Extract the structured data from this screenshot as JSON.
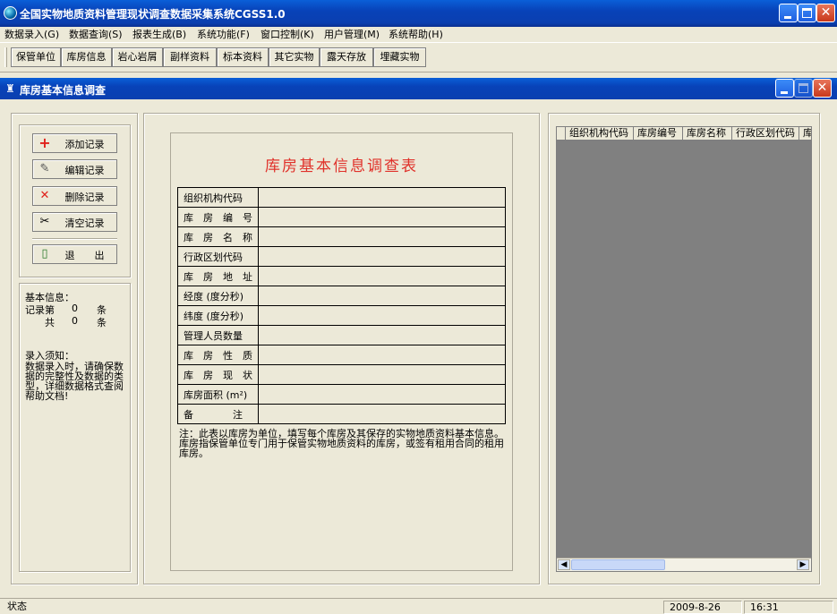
{
  "window": {
    "title": "全国实物地质资料管理现状调查数据采集系统CGSS1.0"
  },
  "menu": [
    "数据录入(G)",
    "数据查询(S)",
    "报表生成(B)",
    "系统功能(F)",
    "窗口控制(K)",
    "用户管理(M)",
    "系统帮助(H)"
  ],
  "toolbar": [
    "保管单位",
    "库房信息",
    "岩心岩屑",
    "副样资料",
    "标本资料",
    "其它实物",
    "露天存放",
    "埋藏实物"
  ],
  "child": {
    "title": "库房基本信息调查"
  },
  "actions": {
    "add": "添加记录",
    "edit": "编辑记录",
    "delete": "删除记录",
    "clear": "清空记录",
    "exit": "退　　出"
  },
  "info": {
    "heading": "基本信息：",
    "record_label": "记录第",
    "record_no": "0",
    "record_unit": "条",
    "total_label": "共",
    "total": "0",
    "total_unit": "条",
    "notice_heading": "录入须知：",
    "notice_text": "数据录入时，请确保数据的完整性及数据的类型，详细数据格式查阅帮助文档!"
  },
  "form": {
    "title": "库房基本信息调查表",
    "fields": [
      "组织机构代码",
      "库　房　编　号",
      "库　房　名　称",
      "行政区划代码",
      "库　房　地　址",
      "经度 (度分秒)",
      "纬度 (度分秒)",
      "管理人员数量",
      "库　房　性　质",
      "库　房　现　状",
      "库房面积 (m²)",
      "备　　　　注"
    ],
    "note": "注：此表以库房为单位，填写每个库房及其保存的实物地质资料基本信息。库房指保管单位专门用于保管实物地质资料的库房，或签有租用合同的租用库房。"
  },
  "grid": {
    "columns": [
      "组织机构代码",
      "库房编号",
      "库房名称",
      "行政区划代码",
      "库"
    ]
  },
  "status": {
    "label": "状态",
    "date": "2009-8-26",
    "time": "16:31"
  }
}
